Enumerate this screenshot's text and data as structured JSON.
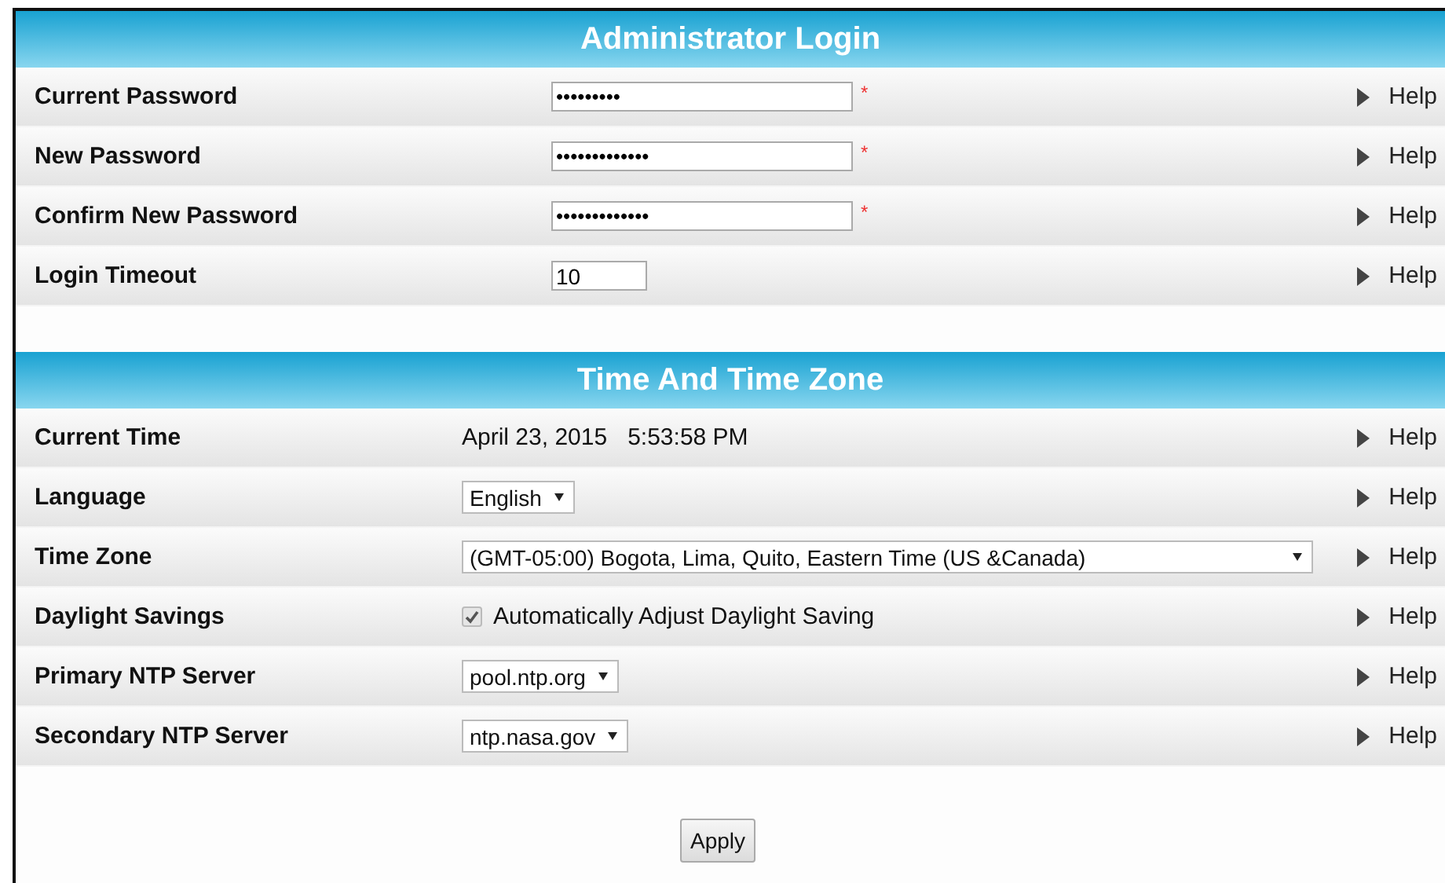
{
  "sections": [
    {
      "title": "Administrator Login",
      "rows": [
        {
          "kind": "password",
          "label": "Current Password",
          "value": "•••••••••",
          "required_mark": "*",
          "help": "Help"
        },
        {
          "kind": "password",
          "label": "New Password",
          "value": "•••••••••••••",
          "required_mark": "*",
          "help": "Help"
        },
        {
          "kind": "password",
          "label": "Confirm New Password",
          "value": "•••••••••••••",
          "required_mark": "*",
          "help": "Help"
        },
        {
          "kind": "short",
          "label": "Login Timeout",
          "value": "10",
          "help": "Help"
        }
      ]
    },
    {
      "title": "Time And Time Zone",
      "rows": [
        {
          "kind": "static",
          "label": "Current Time",
          "value": "April 23, 2015",
          "value_2": "5:53:58 PM",
          "help": "Help"
        },
        {
          "kind": "select",
          "label": "Language",
          "value": "English",
          "full_width": false,
          "help": "Help"
        },
        {
          "kind": "select",
          "label": "Time Zone",
          "value": "(GMT-05:00) Bogota, Lima, Quito, Eastern Time (US &Canada)",
          "full_width": true,
          "help": "Help"
        },
        {
          "kind": "checkbox",
          "label": "Daylight Savings",
          "value": "Automatically Adjust Daylight Saving",
          "checked": true,
          "help": "Help"
        },
        {
          "kind": "select",
          "label": "Primary NTP Server",
          "value": "pool.ntp.org",
          "full_width": false,
          "help": "Help"
        },
        {
          "kind": "select",
          "label": "Secondary NTP Server",
          "value": "ntp.nasa.gov",
          "full_width": false,
          "help": "Help"
        }
      ]
    }
  ],
  "apply_button": "Apply"
}
